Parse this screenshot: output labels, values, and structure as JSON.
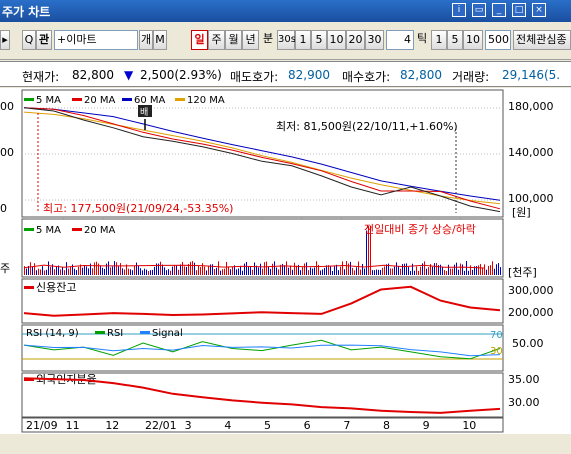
{
  "window": {
    "title": "주가 차트"
  },
  "toolbar": {
    "stock_name": "+이마트",
    "search_label": "Q",
    "ticker_btn": "관",
    "mode_btn1": "개",
    "mode_btn2": "M",
    "periods": [
      "일",
      "주",
      "월",
      "년"
    ],
    "selected_period": "일",
    "minute_label": "분",
    "minute_options": [
      "30s",
      "1",
      "5",
      "10",
      "20",
      "30"
    ],
    "tick_value": "4",
    "tick_label": "틱",
    "tick_options": [
      "1",
      "5",
      "10"
    ],
    "count": "500",
    "watch_label": "전체관심종"
  },
  "quote": {
    "current_label": "현재가:",
    "current_value": "82,800",
    "change_value": "2,500(2.93%)",
    "ask_label": "매도호가:",
    "ask_value": "82,900",
    "bid_label": "매수호가:",
    "bid_value": "82,800",
    "volume_label": "거래량:",
    "volume_value": "29,146(5."
  },
  "chart_data": [
    {
      "type": "line",
      "title": "",
      "series": [
        {
          "name": "5 MA",
          "color": "#00a000"
        },
        {
          "name": "20 MA",
          "color": "#e00000"
        },
        {
          "name": "60 MA",
          "color": "#0000c0"
        },
        {
          "name": "120 MA",
          "color": "#e0a000"
        }
      ],
      "x": [
        "21/09",
        "11",
        "12",
        "22/01",
        "3",
        "4",
        "5",
        "6",
        "7",
        "8",
        "9",
        "10"
      ],
      "ylim": [
        80000,
        190000
      ],
      "yticks": [
        "180,000",
        "140,000",
        "100,000"
      ],
      "unit_label": "[원]",
      "left_ticks": [
        "00",
        "00",
        "0"
      ],
      "price_close": [
        176000,
        173000,
        165000,
        158000,
        150000,
        146000,
        141000,
        135000,
        128000,
        124000,
        115000,
        105000,
        98000,
        105000,
        97000,
        88000,
        83000
      ],
      "ma120": [
        172000,
        170000,
        166000,
        161000,
        156000,
        151000,
        146000,
        140000,
        133000,
        127000,
        120000,
        113000,
        107000,
        102000,
        97000,
        93000,
        90000
      ],
      "annotations": {
        "high": "최고: 177,500원(21/09/24,-53.35%)",
        "low": "최저: 81,500원(22/10/11,+1.60%)",
        "marker": "배"
      }
    },
    {
      "type": "bar",
      "title": "",
      "series": [
        {
          "name": "5 MA",
          "color": "#00a000"
        },
        {
          "name": "20 MA",
          "color": "#e00000"
        }
      ],
      "annotation": "전일대비 종가 상승/하락",
      "unit_label": "[천주]",
      "left_ticks": [
        "주"
      ]
    },
    {
      "type": "line",
      "title": "신용잔고",
      "yticks": [
        "300,000",
        "200,000"
      ],
      "values": [
        215000,
        205000,
        210000,
        215000,
        212000,
        208000,
        210000,
        214000,
        218000,
        215000,
        212000,
        250000,
        300000,
        310000,
        260000,
        235000,
        225000
      ]
    },
    {
      "type": "line",
      "title": "RSI (14, 9)",
      "series": [
        {
          "name": "RSI",
          "color": "#00a000"
        },
        {
          "name": "Signal",
          "color": "#2080ff"
        }
      ],
      "levels": [
        "70",
        "30"
      ],
      "yticks": [
        "50.00"
      ],
      "values": [
        55,
        48,
        52,
        40,
        58,
        45,
        60,
        50,
        47,
        55,
        62,
        48,
        52,
        45,
        38,
        35,
        50
      ]
    },
    {
      "type": "line",
      "title": "외국인지분율",
      "yticks": [
        "35.00",
        "30.00"
      ],
      "values": [
        36.5,
        36.3,
        36.1,
        35.4,
        34.4,
        33.0,
        32.2,
        31.5,
        31.0,
        30.6,
        30.0,
        29.7,
        29.2,
        28.9,
        28.7,
        29.2,
        29.6
      ]
    }
  ]
}
